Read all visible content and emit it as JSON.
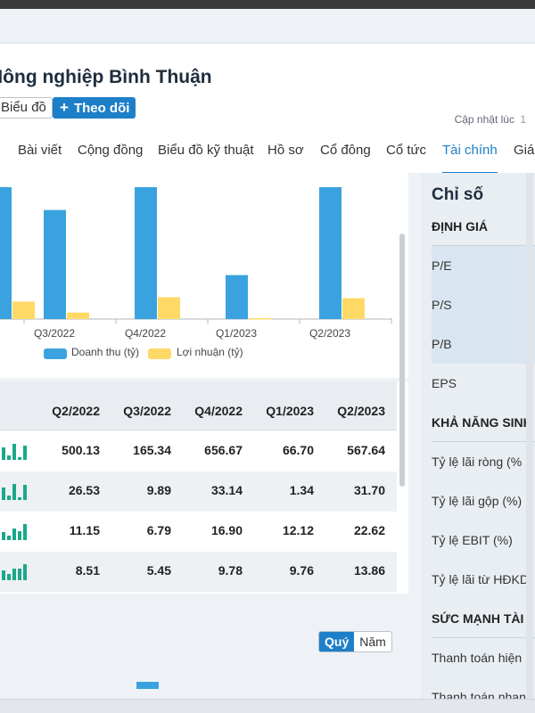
{
  "header": {
    "company_name": "Nông nghiệp Bình Thuận",
    "chart_button": "Biểu đồ",
    "follow_button": "Theo dõi",
    "updated_label": "Cập nhật lúc"
  },
  "tabs": [
    {
      "label": "Bài viết",
      "active": false
    },
    {
      "label": "Cộng đồng",
      "active": false
    },
    {
      "label": "Biểu đồ kỹ thuật",
      "active": false
    },
    {
      "label": "Hồ sơ",
      "active": false
    },
    {
      "label": "Cổ đông",
      "active": false
    },
    {
      "label": "Cổ tức",
      "active": false
    },
    {
      "label": "Tài chính",
      "active": true
    },
    {
      "label": "Giá",
      "active": false
    }
  ],
  "colors": {
    "accent": "#1e7fc9",
    "revenue": "#3aa3df",
    "profit": "#ffd966",
    "spark": "#1aa88a"
  },
  "chart_data": {
    "type": "bar",
    "categories": [
      "Q2/2022",
      "Q3/2022",
      "Q4/2022",
      "Q1/2023",
      "Q2/2023"
    ],
    "series": [
      {
        "name": "Doanh thu (tỷ)",
        "values": [
          500.13,
          165.34,
          656.67,
          66.7,
          567.64
        ]
      },
      {
        "name": "Lợi nhuận (tỷ)",
        "values": [
          26.53,
          9.89,
          33.14,
          1.34,
          31.7
        ]
      }
    ],
    "ylim": [
      0,
      200
    ],
    "tick_labels_visible": [
      "Q3/2022",
      "Q4/2022",
      "Q1/2023",
      "Q2/2023"
    ],
    "legend_position": "bottom",
    "grid": true
  },
  "table": {
    "columns": [
      "Q2/2022",
      "Q3/2022",
      "Q4/2022",
      "Q1/2023",
      "Q2/2023"
    ],
    "rows": [
      {
        "values": [
          "500.13",
          "165.34",
          "656.67",
          "66.70",
          "567.64"
        ],
        "trend": [
          500.13,
          165.34,
          656.67,
          66.7,
          567.64
        ]
      },
      {
        "values": [
          "26.53",
          "9.89",
          "33.14",
          "1.34",
          "31.70"
        ],
        "trend": [
          26.53,
          9.89,
          33.14,
          1.34,
          31.7
        ]
      },
      {
        "values": [
          "11.15",
          "6.79",
          "16.90",
          "12.12",
          "22.62"
        ],
        "trend": [
          11.15,
          6.79,
          16.9,
          12.12,
          22.62
        ]
      },
      {
        "values": [
          "8.51",
          "5.45",
          "9.78",
          "9.76",
          "13.86"
        ],
        "trend": [
          8.51,
          5.45,
          9.78,
          9.76,
          13.86
        ]
      }
    ]
  },
  "period_toggle": {
    "quarter": "Quý",
    "year": "Năm",
    "selected": "quarter"
  },
  "side": {
    "title": "Chỉ số",
    "sections": [
      {
        "heading": "ĐỊNH GIÁ",
        "items": [
          "P/E",
          "P/S",
          "P/B",
          "EPS"
        ]
      },
      {
        "heading": "KHẢ NĂNG SINH",
        "items": [
          "Tỷ lệ lãi ròng (%",
          "Tỷ lệ lãi gộp (%)",
          "Tỷ lệ EBIT (%)",
          "Tỷ lệ lãi từ HĐKD"
        ]
      },
      {
        "heading": "SỨC MẠNH TÀI",
        "items": [
          "Thanh toán hiện",
          "Thanh toán nhan"
        ]
      }
    ]
  }
}
